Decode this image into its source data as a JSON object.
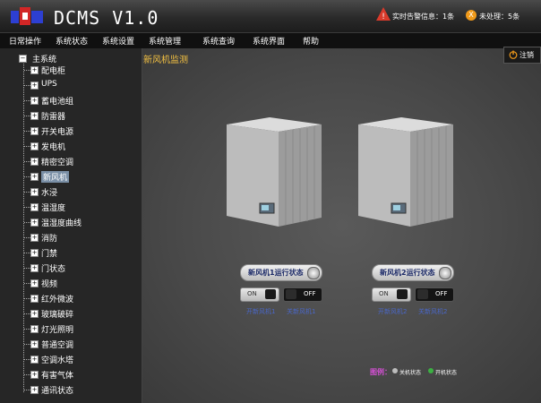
{
  "header": {
    "title": "DCMS V1.0",
    "alarm_text": "实时告警信息：1条",
    "pending_text": "未处理：5条",
    "pending_icon": "X",
    "logo_icon": "company-logo"
  },
  "menu": [
    "日常操作",
    "系统状态",
    "系统设置",
    "系统管理",
    "系统查询",
    "系统界面",
    "帮助"
  ],
  "sidebar": {
    "root": "主系统",
    "items": [
      "配电柜",
      "UPS",
      "蓄电池组",
      "防雷器",
      "开关电源",
      "发电机",
      "精密空调",
      "新风机",
      "水浸",
      "温湿度",
      "温湿度曲线",
      "消防",
      "门禁",
      "门状态",
      "视频",
      "红外微波",
      "玻璃破碎",
      "灯光照明",
      "普通空调",
      "空调水塔",
      "有害气体",
      "通讯状态"
    ],
    "selected": "新风机"
  },
  "page": {
    "title": "新风机监测",
    "logout_label": "注销"
  },
  "units": [
    {
      "status_label": "新风机1运行状态",
      "on_label": "ON",
      "off_label": "OFF",
      "on_caption": "开新风机1",
      "off_caption": "关新风机1"
    },
    {
      "status_label": "新风机2运行状态",
      "on_label": "ON",
      "off_label": "OFF",
      "on_caption": "开新风机2",
      "off_caption": "关新风机2"
    }
  ],
  "legend": {
    "title": "图例：",
    "off_state": "关机状态",
    "on_state": "开机状态"
  },
  "colors": {
    "accent_title": "#f5c242",
    "selected_bg": "#7a8fa6",
    "alarm": "#d93a2b",
    "pending": "#f09a1a",
    "legend_on": "#3cb043",
    "legend_off": "#bdbdbd"
  }
}
